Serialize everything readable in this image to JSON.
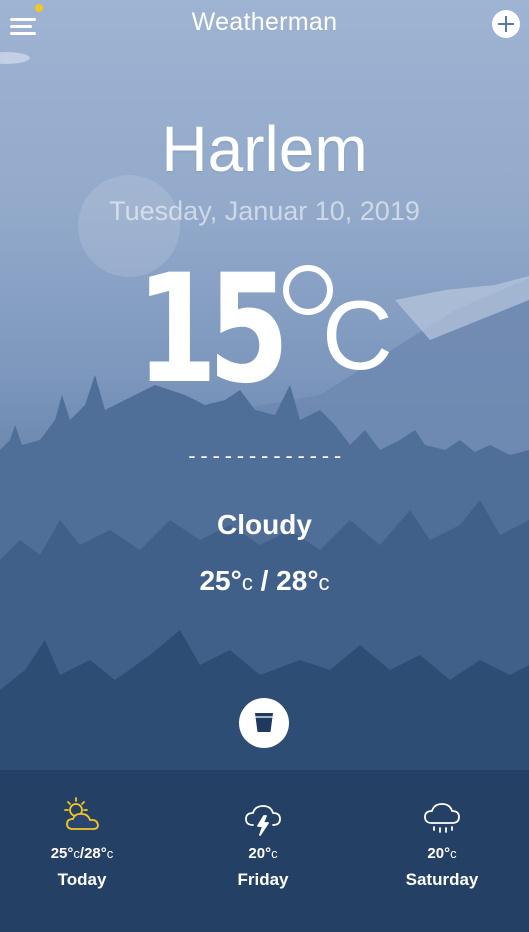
{
  "header": {
    "app_title": "Weatherman",
    "menu_icon": "hamburger-menu-icon",
    "add_icon": "plus-icon",
    "notification_dot_color": "#f3c623"
  },
  "location": {
    "city": "Harlem",
    "date": "Tuesday, Januar 10, 2019"
  },
  "current": {
    "temp_value": "15",
    "temp_unit": "C",
    "divider": "-------------",
    "condition": "Cloudy",
    "low": "25",
    "high": "28",
    "range_unit": "c",
    "range_sep": "/"
  },
  "actions": {
    "cup_icon": "glass-icon"
  },
  "forecast": [
    {
      "icon": "sun-cloud-icon",
      "icon_color": "#f3c623",
      "temp": "25",
      "temp_high": "28",
      "unit": "c",
      "sep": "/",
      "day": "Today"
    },
    {
      "icon": "thunderstorm-icon",
      "icon_color": "#ffffff",
      "temp": "20",
      "unit": "c",
      "day": "Friday"
    },
    {
      "icon": "rain-icon",
      "icon_color": "#ffffff",
      "temp": "20",
      "unit": "c",
      "day": "Saturday"
    }
  ],
  "colors": {
    "background_top": "#9fb3d2",
    "background_bottom": "#1c3354",
    "accent": "#f3c623",
    "text": "#ffffff"
  }
}
